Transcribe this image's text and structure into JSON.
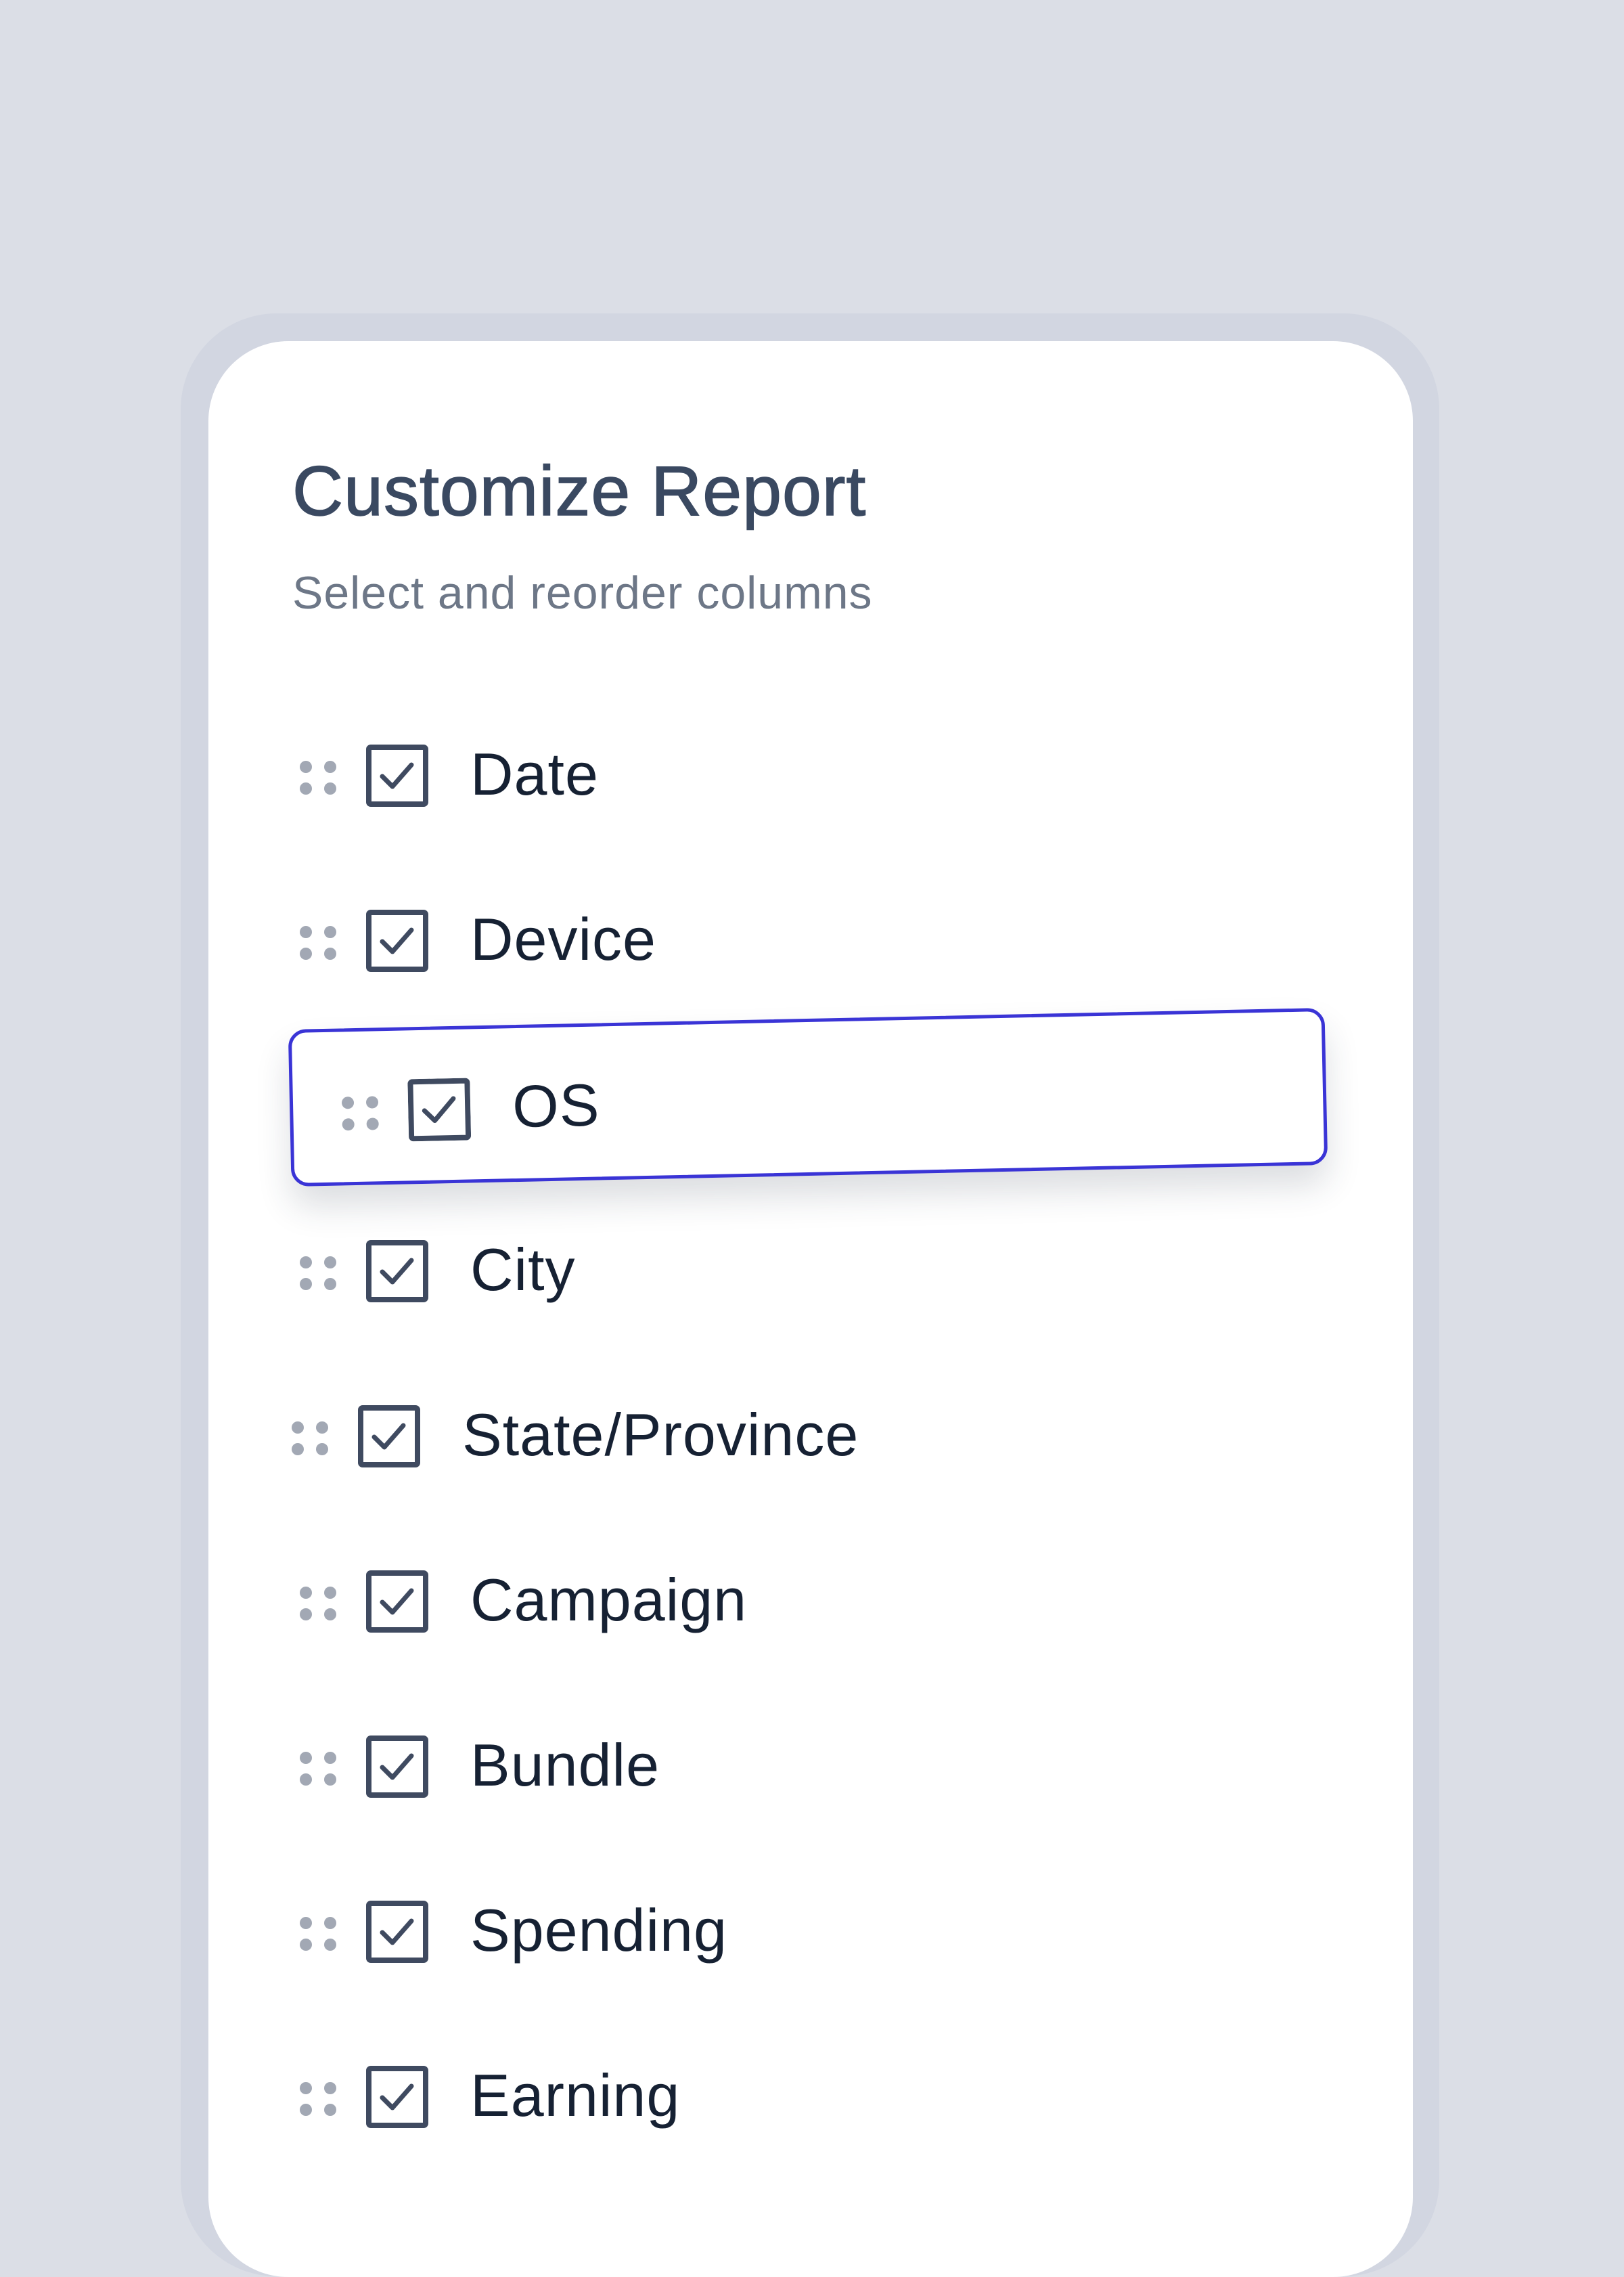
{
  "panel": {
    "title": "Customize Report",
    "subtitle": "Select and reorder columns"
  },
  "columns": [
    {
      "label": "Date",
      "checked": true
    },
    {
      "label": "Device",
      "checked": true
    },
    {
      "label": "OS",
      "checked": true,
      "state": "dragging"
    },
    {
      "label": "City",
      "checked": true
    },
    {
      "label": "State/Province",
      "checked": true
    },
    {
      "label": "Campaign",
      "checked": true
    },
    {
      "label": "Bundle",
      "checked": true
    },
    {
      "label": "Spending",
      "checked": true
    },
    {
      "label": "Earning",
      "checked": true
    }
  ],
  "icons": {
    "handle": "drag-handle-icon",
    "checkbox": "checkbox-checked-icon"
  },
  "colors": {
    "page_background": "#dbdee6",
    "frame": "#d2d6e1",
    "card": "#ffffff",
    "title": "#3a4961",
    "subtitle": "#6d7787",
    "label": "#162133",
    "checkbox": "#3f4a60",
    "handle_dots": "#a2a8b4",
    "drag_outline": "#3a34d6"
  }
}
